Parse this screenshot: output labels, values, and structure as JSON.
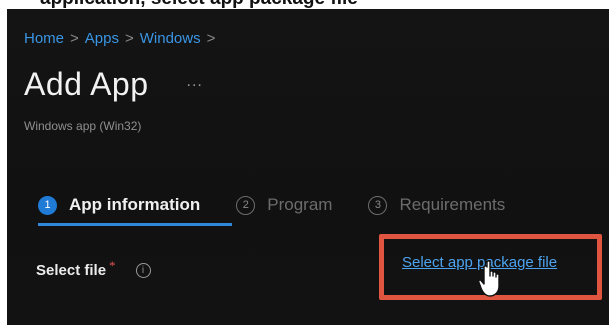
{
  "top_strip_text": "application, select app package file",
  "breadcrumb": {
    "items": [
      "Home",
      "Apps",
      "Windows"
    ],
    "separator": ">"
  },
  "header": {
    "title": "Add App",
    "more_label": "...",
    "subtitle": "Windows app (Win32)"
  },
  "tabs": [
    {
      "step": "1",
      "label": "App information",
      "active": true
    },
    {
      "step": "2",
      "label": "Program",
      "active": false
    },
    {
      "step": "3",
      "label": "Requirements",
      "active": false
    }
  ],
  "form": {
    "select_file_label": "Select file",
    "required_marker": "*",
    "info_icon": "info-icon",
    "info_glyph": "i",
    "select_link": "Select app package file"
  },
  "colors": {
    "accent": "#2f88dc",
    "link": "#4da3f0",
    "highlight": "#e0553f",
    "background": "#121212"
  },
  "icons": {
    "cursor": "hand-pointer-icon",
    "info": "info-icon"
  }
}
